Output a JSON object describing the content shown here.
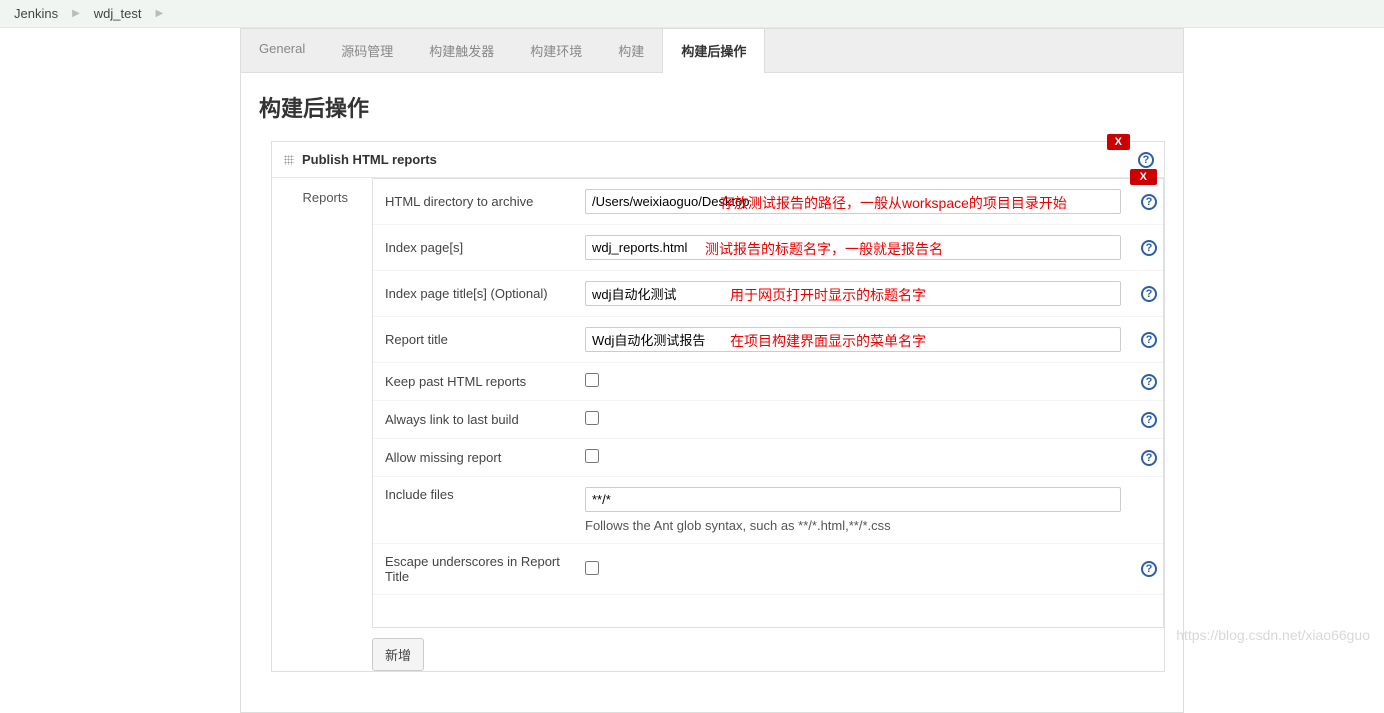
{
  "breadcrumb": {
    "jenkins": "Jenkins",
    "project": "wdj_test"
  },
  "tabs": {
    "general": "General",
    "scm": "源码管理",
    "triggers": "构建触发器",
    "env": "构建环境",
    "build": "构建",
    "post": "构建后操作"
  },
  "page_title": "构建后操作",
  "block": {
    "title": "Publish HTML reports",
    "reports_label": "Reports",
    "x": "X",
    "help": "?"
  },
  "fields": {
    "html_dir": {
      "label": "HTML directory to archive",
      "value": "/Users/weixiaoguo/Desktop"
    },
    "index_page": {
      "label": "Index page[s]",
      "value": "wdj_reports.html"
    },
    "index_title": {
      "label": "Index page title[s] (Optional)",
      "value": "wdj自动化测试"
    },
    "report_title": {
      "label": "Report title",
      "value": "Wdj自动化测试报告"
    },
    "keep_past": {
      "label": "Keep past HTML reports"
    },
    "always_link": {
      "label": "Always link to last build"
    },
    "allow_missing": {
      "label": "Allow missing report"
    },
    "include_files": {
      "label": "Include files",
      "value": "**/*",
      "hint": "Follows the Ant glob syntax, such as **/*.html,**/*.css"
    },
    "escape_underscores": {
      "label": "Escape underscores in Report Title"
    }
  },
  "annotations": {
    "html_dir": "存放测试报告的路径，一般从workspace的项目目录开始",
    "index_page": "测试报告的标题名字，一般就是报告名",
    "index_title": "用于网页打开时显示的标题名字",
    "report_title": "在项目构建界面显示的菜单名字"
  },
  "add_btn": "新增",
  "watermark": "https://blog.csdn.net/xiao66guo"
}
